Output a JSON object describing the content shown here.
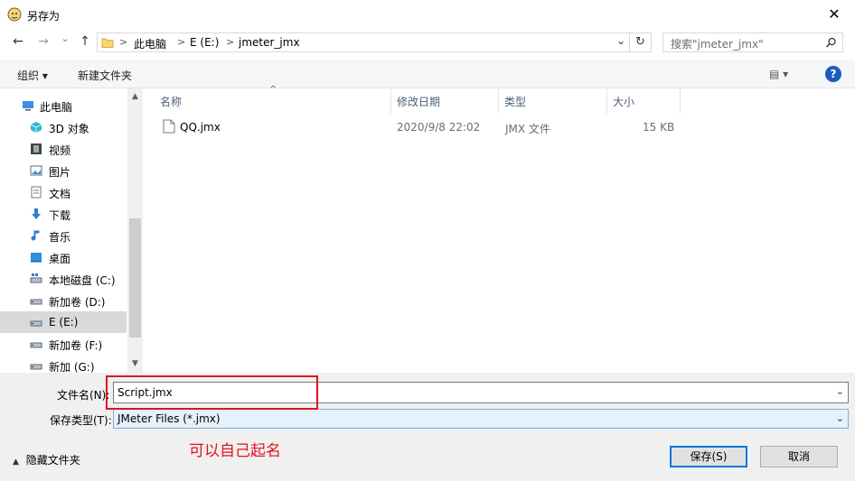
{
  "window": {
    "title": "另存为",
    "close_glyph": "✕"
  },
  "nav_buttons": {
    "back": "←",
    "forward": "→",
    "recent": "⌄",
    "up": "↑"
  },
  "address": {
    "crumbs": [
      "此电脑",
      "E (E:)",
      "jmeter_jmx"
    ],
    "separator": ">",
    "dropdown": "⌄",
    "refresh": "↻"
  },
  "search": {
    "placeholder": "搜索\"jmeter_jmx\"",
    "icon": "search-icon"
  },
  "toolbar": {
    "organize": "组织 ▾",
    "new_folder": "新建文件夹",
    "view_glyph": "▤ ▾",
    "help": "?"
  },
  "nav_pane": {
    "items": [
      {
        "label": "此电脑",
        "icon": "computer-icon",
        "color": "#3a8ee6"
      },
      {
        "label": "3D 对象",
        "icon": "cube-icon",
        "color": "#2fb8d6"
      },
      {
        "label": "视频",
        "icon": "film-icon",
        "color": "#555555"
      },
      {
        "label": "图片",
        "icon": "picture-icon",
        "color": "#3a8ee6"
      },
      {
        "label": "文档",
        "icon": "document-icon",
        "color": "#6b7b8c"
      },
      {
        "label": "下载",
        "icon": "download-icon",
        "color": "#2f7bd6"
      },
      {
        "label": "音乐",
        "icon": "music-icon",
        "color": "#2f7bd6"
      },
      {
        "label": "桌面",
        "icon": "desktop-icon",
        "color": "#2f8ee0"
      },
      {
        "label": "本地磁盘 (C:)",
        "icon": "drive-c-icon",
        "color": "#5a6a7a"
      },
      {
        "label": "新加卷 (D:)",
        "icon": "drive-icon",
        "color": "#5a6a7a"
      },
      {
        "label": "E (E:)",
        "icon": "drive-icon",
        "color": "#5a6a7a"
      },
      {
        "label": "新加卷 (F:)",
        "icon": "drive-icon",
        "color": "#5a6a7a"
      },
      {
        "label": "新加 (G:)",
        "icon": "drive-icon",
        "color": "#5a6a7a"
      }
    ],
    "selected": "E (E:)",
    "scroll_up": "▲",
    "scroll_down": "▼"
  },
  "file_list": {
    "sort_glyph": "^",
    "columns": [
      "名称",
      "修改日期",
      "类型",
      "大小"
    ],
    "rows": [
      {
        "name": "QQ.jmx",
        "modified": "2020/9/8 22:02",
        "type": "JMX 文件",
        "size": "15 KB"
      }
    ]
  },
  "form": {
    "filename_label": "文件名(N):",
    "filename_value": "Script.jmx",
    "filetype_label": "保存类型(T):",
    "filetype_value": "JMeter Files (*.jmx)",
    "dropdown_glyph": "⌄"
  },
  "annotation": {
    "text": "可以自己起名",
    "color": "#e0141e"
  },
  "footer": {
    "hide_folders": "隐藏文件夹",
    "hide_glyph": "▲",
    "save": "保存(S)",
    "cancel": "取消"
  }
}
